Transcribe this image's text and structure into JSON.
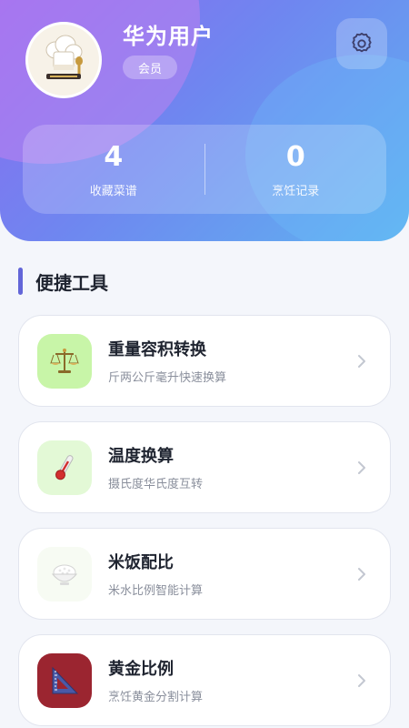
{
  "profile": {
    "username": "华为用户",
    "badge": "会员"
  },
  "stats": [
    {
      "value": "4",
      "label": "收藏菜谱"
    },
    {
      "value": "0",
      "label": "烹饪记录"
    }
  ],
  "section": {
    "title": "便捷工具"
  },
  "tools": [
    {
      "title": "重量容积转换",
      "desc": "斤两公斤毫升快速换算",
      "icon": "balance-scale-icon",
      "icon_bg": "#c8f5a8"
    },
    {
      "title": "温度换算",
      "desc": "摄氏度华氏度互转",
      "icon": "thermometer-icon",
      "icon_bg": "#e3f9d6"
    },
    {
      "title": "米饭配比",
      "desc": "米水比例智能计算",
      "icon": "rice-bowl-icon",
      "icon_bg": "#f7fbf3"
    },
    {
      "title": "黄金比例",
      "desc": "烹饪黄金分割计算",
      "icon": "set-square-icon",
      "icon_bg": "#9b2530"
    }
  ],
  "colors": {
    "accent": "#6366d8",
    "header_start": "#8a6bf0",
    "header_end": "#5fb3f0"
  }
}
